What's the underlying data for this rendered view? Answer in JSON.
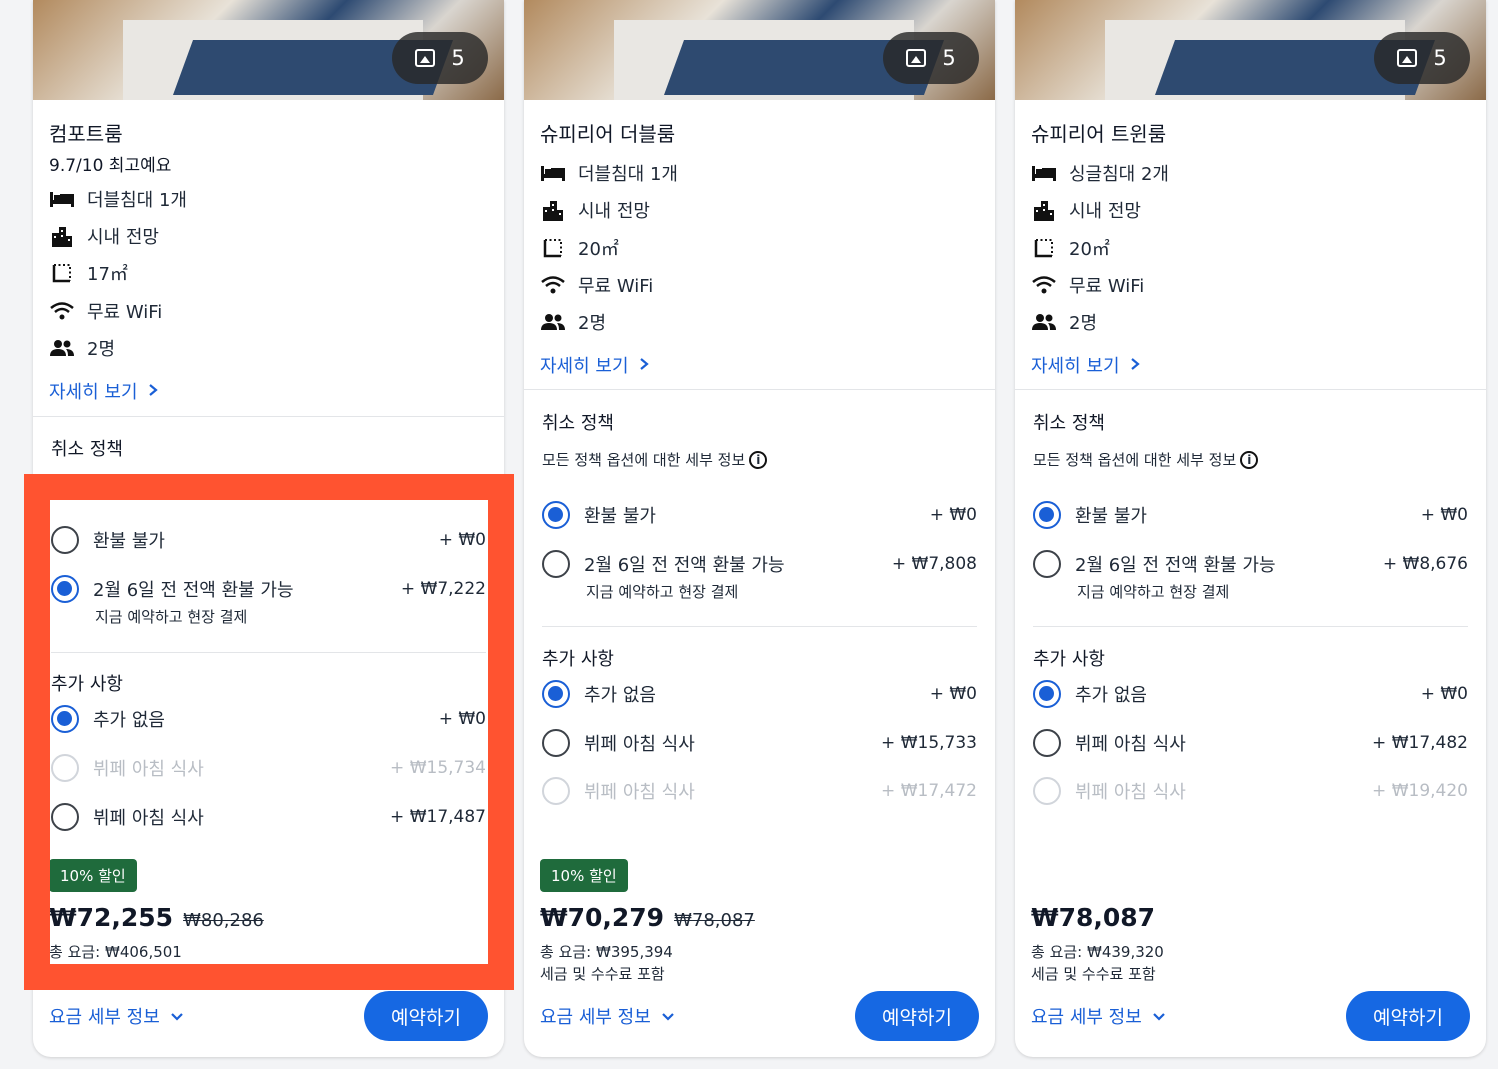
{
  "cards": [
    {
      "photo_count": "5",
      "title": "컴포트룸",
      "rating": "9.7/10 최고예요",
      "features": {
        "bed": "더블침대 1개",
        "view": "시내 전망",
        "size": "17㎡",
        "wifi": "무료 WiFi",
        "guests": "2명"
      },
      "more_link": "자세히 보기",
      "cancel_title": "취소 정책",
      "cancel_options": [
        {
          "label": "환불 불가",
          "price": "+ ₩0",
          "selected": false
        },
        {
          "label": "2월 6일 전 전액 환불 가능",
          "price": "+ ₩7,222",
          "sub": "지금 예약하고 현장 결제",
          "selected": true
        }
      ],
      "extras_title": "추가 사항",
      "extras": [
        {
          "label": "추가 없음",
          "price": "+ ₩0",
          "selected": true,
          "disabled": false
        },
        {
          "label": "뷔페 아침 식사",
          "price": "+ ₩15,734",
          "selected": false,
          "disabled": true
        },
        {
          "label": "뷔페 아침 식사",
          "price": "+ ₩17,487",
          "selected": false,
          "disabled": false
        }
      ],
      "discount_badge": "10% 할인",
      "price": "₩72,255",
      "original_price": "₩80,286",
      "total": "총 요금: ₩406,501",
      "price_details_link": "요금 세부 정보",
      "book_button": "예약하기"
    },
    {
      "photo_count": "5",
      "title": "슈피리어 더블룸",
      "features": {
        "bed": "더블침대 1개",
        "view": "시내 전망",
        "size": "20㎡",
        "wifi": "무료 WiFi",
        "guests": "2명"
      },
      "more_link": "자세히 보기",
      "cancel_title": "취소 정책",
      "policy_note": "모든 정책 옵션에 대한 세부 정보",
      "cancel_options": [
        {
          "label": "환불 불가",
          "price": "+ ₩0",
          "selected": true
        },
        {
          "label": "2월 6일 전 전액 환불 가능",
          "price": "+ ₩7,808",
          "sub": "지금 예약하고 현장 결제",
          "selected": false
        }
      ],
      "extras_title": "추가 사항",
      "extras": [
        {
          "label": "추가 없음",
          "price": "+ ₩0",
          "selected": true,
          "disabled": false
        },
        {
          "label": "뷔페 아침 식사",
          "price": "+ ₩15,733",
          "selected": false,
          "disabled": false
        },
        {
          "label": "뷔페 아침 식사",
          "price": "+ ₩17,472",
          "selected": false,
          "disabled": true
        }
      ],
      "discount_badge": "10% 할인",
      "price": "₩70,279",
      "original_price": "₩78,087",
      "total": "총 요금: ₩395,394",
      "tax_note": "세금 및 수수료 포함",
      "price_details_link": "요금 세부 정보",
      "book_button": "예약하기"
    },
    {
      "photo_count": "5",
      "title": "슈피리어 트윈룸",
      "features": {
        "bed": "싱글침대 2개",
        "view": "시내 전망",
        "size": "20㎡",
        "wifi": "무료 WiFi",
        "guests": "2명"
      },
      "more_link": "자세히 보기",
      "cancel_title": "취소 정책",
      "policy_note": "모든 정책 옵션에 대한 세부 정보",
      "cancel_options": [
        {
          "label": "환불 불가",
          "price": "+ ₩0",
          "selected": true
        },
        {
          "label": "2월 6일 전 전액 환불 가능",
          "price": "+ ₩8,676",
          "sub": "지금 예약하고 현장 결제",
          "selected": false
        }
      ],
      "extras_title": "추가 사항",
      "extras": [
        {
          "label": "추가 없음",
          "price": "+ ₩0",
          "selected": true,
          "disabled": false
        },
        {
          "label": "뷔페 아침 식사",
          "price": "+ ₩17,482",
          "selected": false,
          "disabled": false
        },
        {
          "label": "뷔페 아침 식사",
          "price": "+ ₩19,420",
          "selected": false,
          "disabled": true
        }
      ],
      "price": "₩78,087",
      "total": "총 요금: ₩439,320",
      "tax_note": "세금 및 수수료 포함",
      "price_details_link": "요금 세부 정보",
      "book_button": "예약하기"
    }
  ],
  "colors": {
    "accent": "#1668e3",
    "link": "#1a5fd6",
    "discount": "#1f6b3c",
    "highlight": "#ff5330"
  }
}
